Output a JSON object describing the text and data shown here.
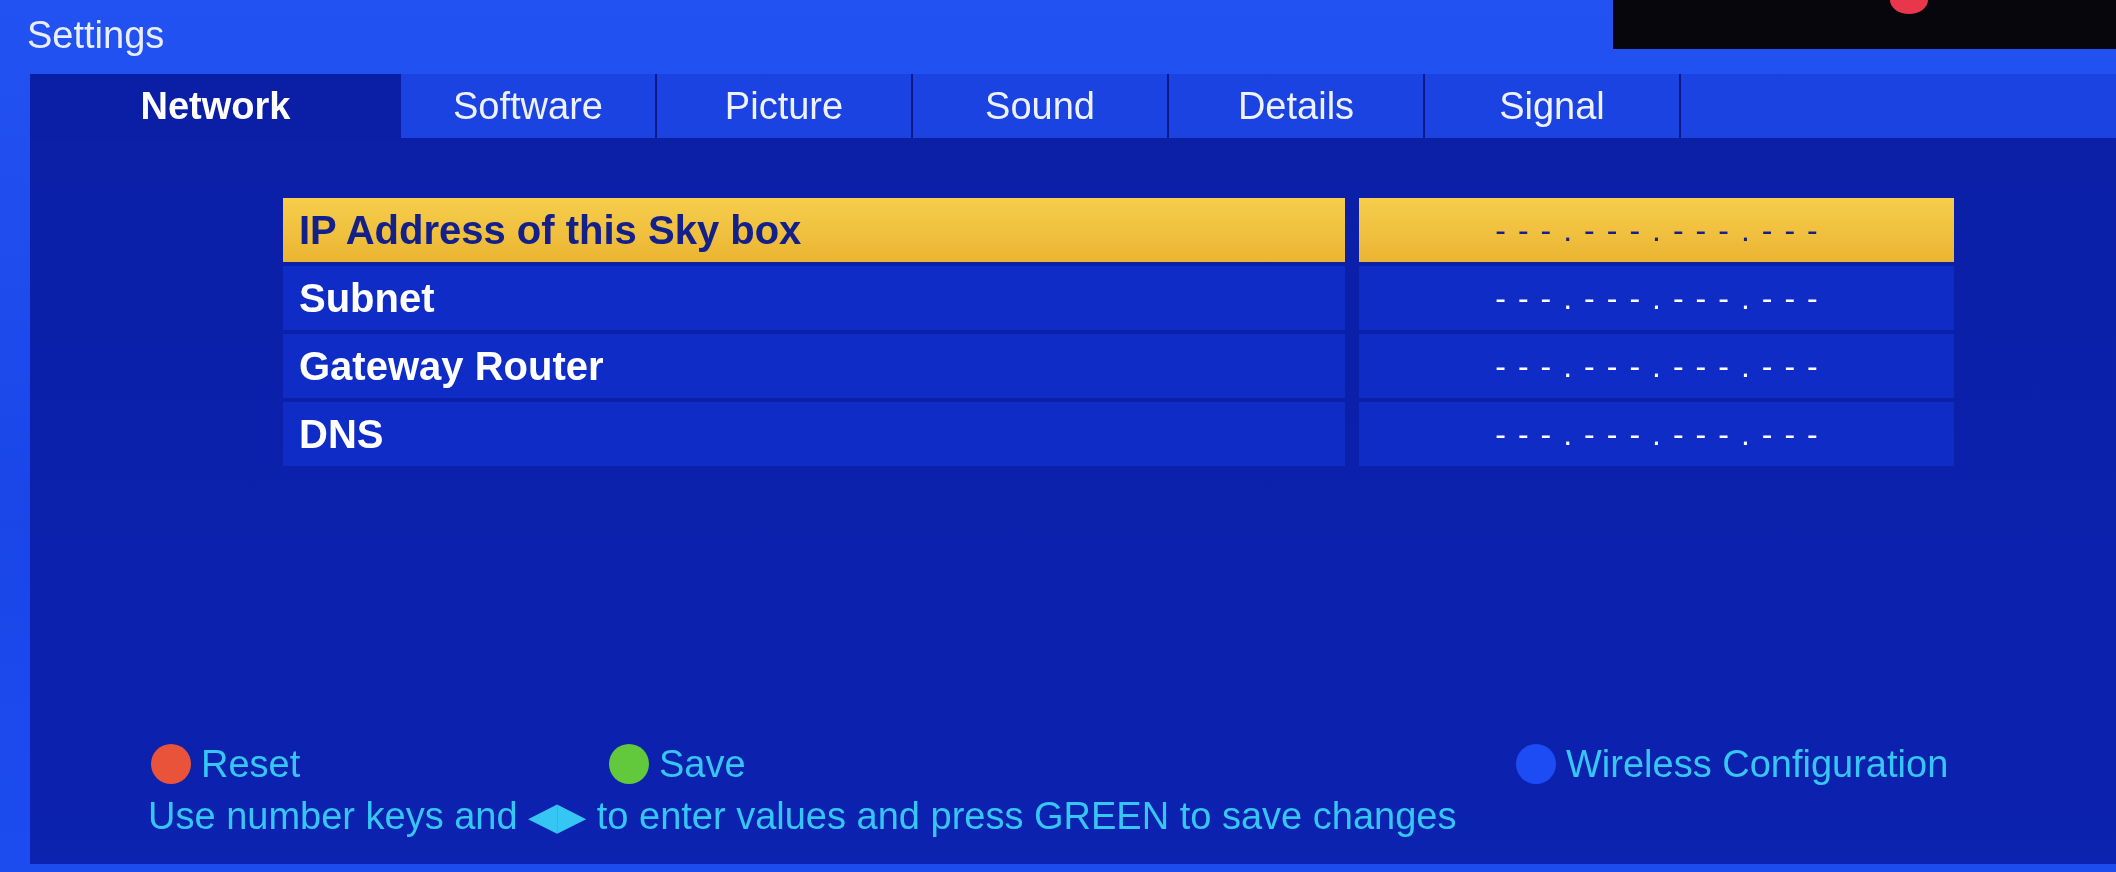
{
  "screen": {
    "title": "Settings"
  },
  "tabs": [
    {
      "label": "Network",
      "selected": true
    },
    {
      "label": "Software",
      "selected": false
    },
    {
      "label": "Picture",
      "selected": false
    },
    {
      "label": "Sound",
      "selected": false
    },
    {
      "label": "Details",
      "selected": false
    },
    {
      "label": "Signal",
      "selected": false
    }
  ],
  "rows": [
    {
      "label": "IP Address of this Sky box",
      "value": "---.---.---.---",
      "selected": true
    },
    {
      "label": "Subnet",
      "value": "---.---.---.---",
      "selected": false
    },
    {
      "label": "Gateway Router",
      "value": "---.---.---.---",
      "selected": false
    },
    {
      "label": "DNS",
      "value": "---.---.---.---",
      "selected": false
    }
  ],
  "keys": [
    {
      "label": "Reset",
      "color": "#e8533a"
    },
    {
      "label": "Save",
      "color": "#62c83c"
    },
    {
      "label": "Wireless Configuration",
      "color": "#1d4cf5"
    }
  ],
  "hint": "Use number keys and ◀▶ to enter values and press GREEN to save changes"
}
